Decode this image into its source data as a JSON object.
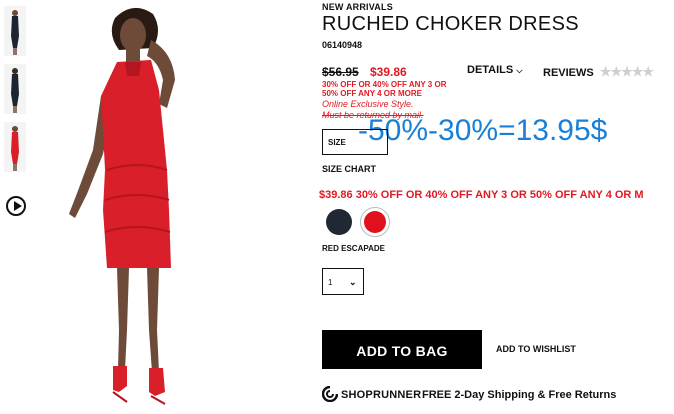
{
  "product": {
    "eyebrow": "NEW ARRIVALS",
    "title": "RUCHED CHOKER DRESS",
    "sku": "06140948",
    "old_price": "$56.95",
    "new_price": "$39.86",
    "promo_small": "30% OFF OR 40% OFF ANY 3 OR 50% OFF ANY 4 OR MORE",
    "online_note_1": "Online Exclusive Style.",
    "online_note_2": "Must be returned by mail."
  },
  "tabs": {
    "details": "DETAILS",
    "reviews": "REVIEWS"
  },
  "overlay_text": "-50%-30%=13.95$",
  "size": {
    "label": "SIZE",
    "chart": "SIZE CHART"
  },
  "promo_line": "$39.86 30% OFF OR 40% OFF ANY 3 OR 50% OFF ANY 4 OR M",
  "colors": {
    "selected_name": "RED ESCAPADE",
    "swatches": [
      {
        "name": "navy",
        "hex": "#202833"
      },
      {
        "name": "red",
        "hex": "#e0101d"
      }
    ]
  },
  "quantity": {
    "value": "1"
  },
  "actions": {
    "add_to_bag": "ADD TO BAG",
    "wishlist": "ADD TO WISHLIST"
  },
  "shoprunner": {
    "brand": "SHOPRUNNER",
    "text": "FREE 2-Day Shipping & Free Returns"
  },
  "accent_colors": {
    "sale_red": "#e01a22",
    "overlay_blue": "#1a7fd6"
  }
}
